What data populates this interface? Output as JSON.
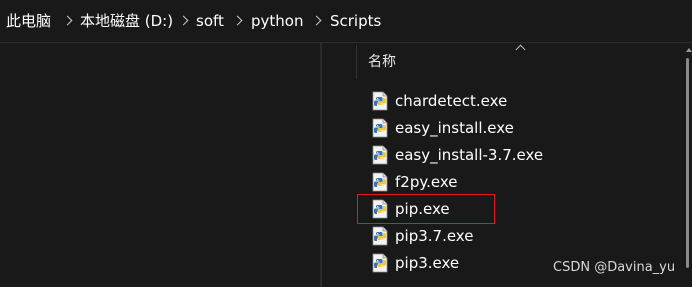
{
  "breadcrumb": [
    {
      "label": "此电脑"
    },
    {
      "label": "本地磁盘 (D:)"
    },
    {
      "label": "soft"
    },
    {
      "label": "python"
    },
    {
      "label": "Scripts"
    }
  ],
  "file_list": {
    "column_header": "名称",
    "items": [
      {
        "name": "chardetect.exe",
        "icon": "python-file-icon"
      },
      {
        "name": "easy_install.exe",
        "icon": "python-file-icon"
      },
      {
        "name": "easy_install-3.7.exe",
        "icon": "python-file-icon"
      },
      {
        "name": "f2py.exe",
        "icon": "python-file-icon"
      },
      {
        "name": "pip.exe",
        "icon": "python-file-icon",
        "highlighted": true
      },
      {
        "name": "pip3.7.exe",
        "icon": "python-file-icon"
      },
      {
        "name": "pip3.exe",
        "icon": "python-file-icon"
      }
    ]
  },
  "highlight_color": "#e0191f",
  "watermark": "CSDN @Davina_yu"
}
